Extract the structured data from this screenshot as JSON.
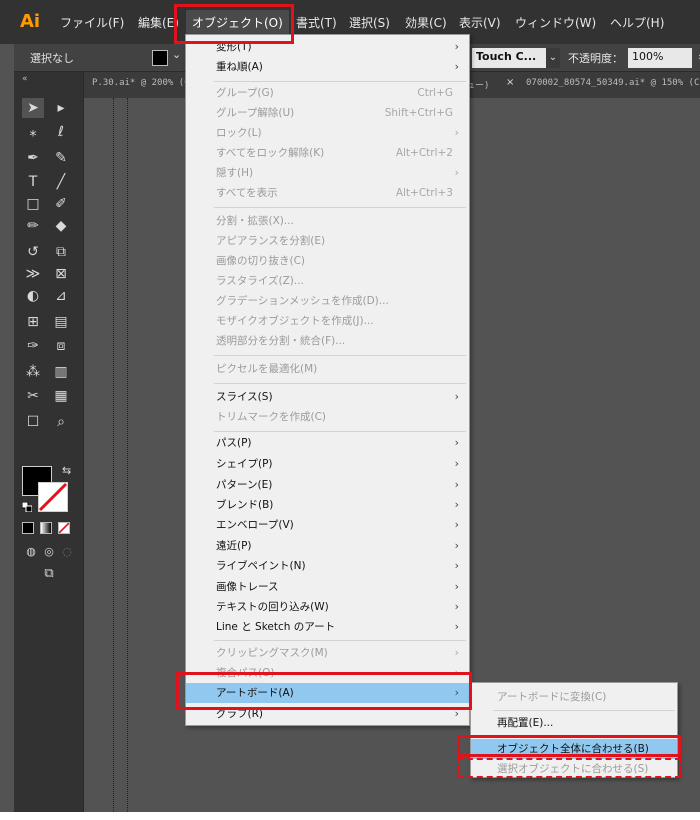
{
  "app": {
    "logo": "Ai"
  },
  "menubar": {
    "items": [
      "ファイル(F)",
      "編集(E)",
      "オブジェクト(O)",
      "書式(T)",
      "選択(S)",
      "効果(C)",
      "表示(V)",
      "ウィンドウ(W)",
      "ヘルプ(H)"
    ]
  },
  "controlbar": {
    "selection": "選択なし",
    "brush_preset": "Touch C...",
    "opacity_label": "不透明度：",
    "opacity_value": "100%"
  },
  "tabs": {
    "first": "P.30.ai* @ 200% (C",
    "middle": "ュー)",
    "active": "070002_80574_50349.ai* @ 150% (C"
  },
  "object_menu": {
    "items": [
      {
        "label": "変形(T)",
        "shortcut": "",
        "submenu": true,
        "disabled": false
      },
      {
        "label": "重ね順(A)",
        "shortcut": "",
        "submenu": true,
        "disabled": false
      },
      {
        "label": "グループ(G)",
        "shortcut": "Ctrl+G",
        "submenu": false,
        "disabled": true
      },
      {
        "label": "グループ解除(U)",
        "shortcut": "Shift+Ctrl+G",
        "submenu": false,
        "disabled": true
      },
      {
        "label": "ロック(L)",
        "shortcut": "",
        "submenu": true,
        "disabled": true
      },
      {
        "label": "すべてをロック解除(K)",
        "shortcut": "Alt+Ctrl+2",
        "submenu": false,
        "disabled": true
      },
      {
        "label": "隠す(H)",
        "shortcut": "",
        "submenu": true,
        "disabled": true
      },
      {
        "label": "すべてを表示",
        "shortcut": "Alt+Ctrl+3",
        "submenu": false,
        "disabled": true
      },
      {
        "label": "分割・拡張(X)...",
        "shortcut": "",
        "submenu": false,
        "disabled": true
      },
      {
        "label": "アピアランスを分割(E)",
        "shortcut": "",
        "submenu": false,
        "disabled": true
      },
      {
        "label": "画像の切り抜き(C)",
        "shortcut": "",
        "submenu": false,
        "disabled": true
      },
      {
        "label": "ラスタライズ(Z)...",
        "shortcut": "",
        "submenu": false,
        "disabled": true
      },
      {
        "label": "グラデーションメッシュを作成(D)...",
        "shortcut": "",
        "submenu": false,
        "disabled": true
      },
      {
        "label": "モザイクオブジェクトを作成(J)...",
        "shortcut": "",
        "submenu": false,
        "disabled": true
      },
      {
        "label": "透明部分を分割・統合(F)...",
        "shortcut": "",
        "submenu": false,
        "disabled": true
      },
      {
        "label": "ピクセルを最適化(M)",
        "shortcut": "",
        "submenu": false,
        "disabled": true
      },
      {
        "label": "スライス(S)",
        "shortcut": "",
        "submenu": true,
        "disabled": false
      },
      {
        "label": "トリムマークを作成(C)",
        "shortcut": "",
        "submenu": false,
        "disabled": true
      },
      {
        "label": "パス(P)",
        "shortcut": "",
        "submenu": true,
        "disabled": false
      },
      {
        "label": "シェイプ(P)",
        "shortcut": "",
        "submenu": true,
        "disabled": false
      },
      {
        "label": "パターン(E)",
        "shortcut": "",
        "submenu": true,
        "disabled": false
      },
      {
        "label": "ブレンド(B)",
        "shortcut": "",
        "submenu": true,
        "disabled": false
      },
      {
        "label": "エンベロープ(V)",
        "shortcut": "",
        "submenu": true,
        "disabled": false
      },
      {
        "label": "遠近(P)",
        "shortcut": "",
        "submenu": true,
        "disabled": false
      },
      {
        "label": "ライブペイント(N)",
        "shortcut": "",
        "submenu": true,
        "disabled": false
      },
      {
        "label": "画像トレース",
        "shortcut": "",
        "submenu": true,
        "disabled": false
      },
      {
        "label": "テキストの回り込み(W)",
        "shortcut": "",
        "submenu": true,
        "disabled": false
      },
      {
        "label": "Line と Sketch のアート",
        "shortcut": "",
        "submenu": true,
        "disabled": false
      },
      {
        "label": "クリッピングマスク(M)",
        "shortcut": "",
        "submenu": true,
        "disabled": true
      },
      {
        "label": "複合パス(O)",
        "shortcut": "",
        "submenu": true,
        "disabled": true
      },
      {
        "label": "アートボード(A)",
        "shortcut": "",
        "submenu": true,
        "disabled": false,
        "highlighted": true
      },
      {
        "label": "グラフ(R)",
        "shortcut": "",
        "submenu": true,
        "disabled": false
      }
    ]
  },
  "artboard_submenu": {
    "items": [
      {
        "label": "アートボードに変換(C)",
        "disabled": true
      },
      {
        "label": "再配置(E)...",
        "disabled": false
      },
      {
        "label": "オブジェクト全体に合わせる(B)",
        "disabled": false,
        "highlighted": true
      },
      {
        "label": "選択オブジェクトに合わせる(S)",
        "disabled": true
      }
    ]
  },
  "icons": {
    "submenu_arrow": "chevron-right-icon",
    "dropdown_arrow": "chevron-down-icon"
  },
  "colors": {
    "highlight": "#90c8f0",
    "annotation": "#e0121b",
    "logo": "#ff9a00"
  }
}
